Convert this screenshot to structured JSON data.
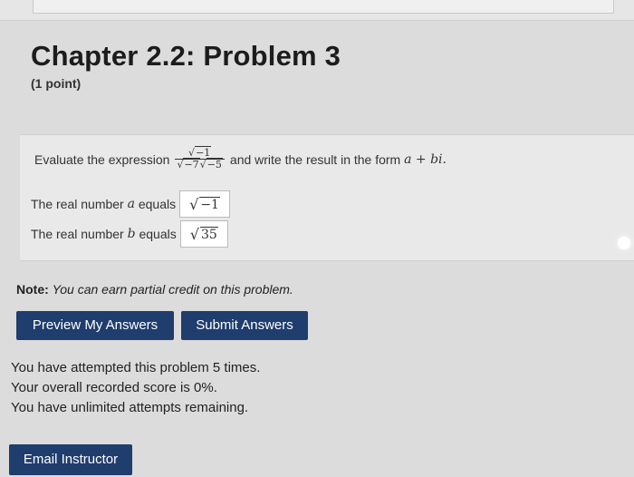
{
  "problem": {
    "title": "Chapter 2.2: Problem 3",
    "points": "(1 point)",
    "prompt_before": "Evaluate the expression",
    "expression": {
      "numerator_radicand": "−1",
      "denominator_radicand_1": "−7",
      "denominator_radicand_2": "−5"
    },
    "prompt_after": "and write the result in the form",
    "form": "a + bi."
  },
  "answers": {
    "real_a": {
      "label_prefix": "The real number",
      "variable": "a",
      "label_suffix": "equals",
      "radicand": "−1"
    },
    "real_b": {
      "label_prefix": "The real number",
      "variable": "b",
      "label_suffix": "equals",
      "radicand": "35"
    }
  },
  "note": {
    "label": "Note:",
    "text": "You can earn partial credit on this problem."
  },
  "buttons": {
    "preview": "Preview My Answers",
    "submit": "Submit Answers",
    "email": "Email Instructor"
  },
  "status": {
    "attempts": "You have attempted this problem 5 times.",
    "score": "Your overall recorded score is 0%.",
    "remaining": "You have unlimited attempts remaining."
  }
}
